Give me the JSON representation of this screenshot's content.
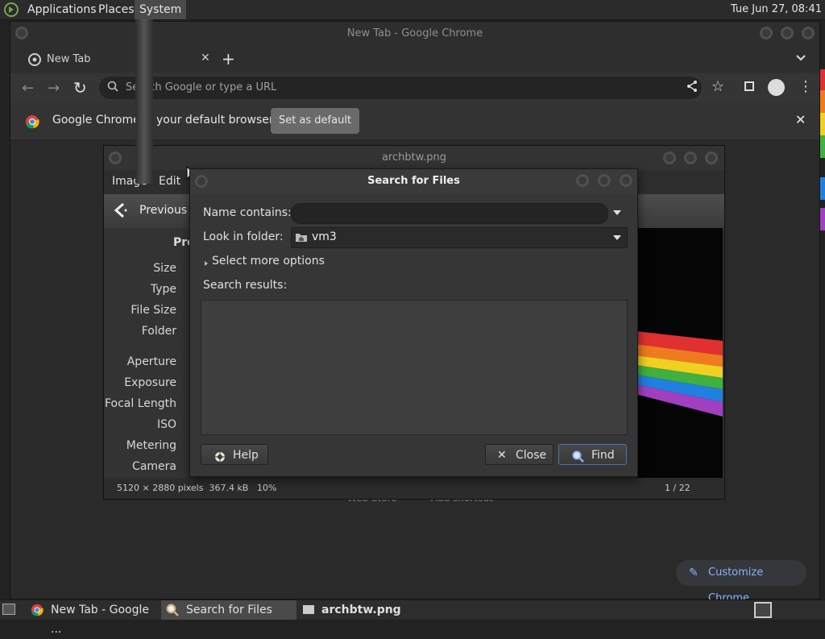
{
  "top_panel": {
    "menus": [
      "Applications",
      "Places",
      "System"
    ],
    "clock": "Tue Jun 27, 08:41"
  },
  "chrome": {
    "window_title": "New Tab - Google Chrome",
    "tab_title": "New Tab",
    "omnibox_placeholder": "Search Google or type a URL",
    "infobar_text_a": "Google Chrome i",
    "infobar_text_b": "your default browser",
    "set_default_label": "Set as default",
    "customize_label": "Customize Chrome",
    "ntp_shortcut_a": "Web Store",
    "ntp_shortcut_b": "Add shortcut"
  },
  "viewer": {
    "title": "archbtw.png",
    "menus": [
      "Image",
      "Edit"
    ],
    "previous_label": "Previous",
    "properties_header": "Pro",
    "props": [
      "Size",
      "Type",
      "File Size",
      "Folder",
      "Aperture",
      "Exposure",
      "Focal Length",
      "ISO",
      "Metering",
      "Camera"
    ],
    "status_left": "5120 × 2880 pixels  367.4 kB   10%",
    "status_right": "1 / 22"
  },
  "dialog": {
    "title": "Search for Files",
    "name_label": "Name contains:",
    "name_value": "",
    "folder_label": "Look in folder:",
    "folder_value": "vm3",
    "more_options": "Select more options",
    "results_label": "Search results:",
    "help_label": "Help",
    "close_label": "Close",
    "find_label": "Find"
  },
  "taskbar": {
    "items": [
      "New Tab - Google ...",
      "Search for Files",
      "archbtw.png"
    ]
  },
  "colors": {
    "accent_blue": "#8ab4f8",
    "rainbow": [
      "#e03030",
      "#f07a20",
      "#f0d020",
      "#40b040",
      "#2080e0",
      "#a040c0"
    ]
  }
}
